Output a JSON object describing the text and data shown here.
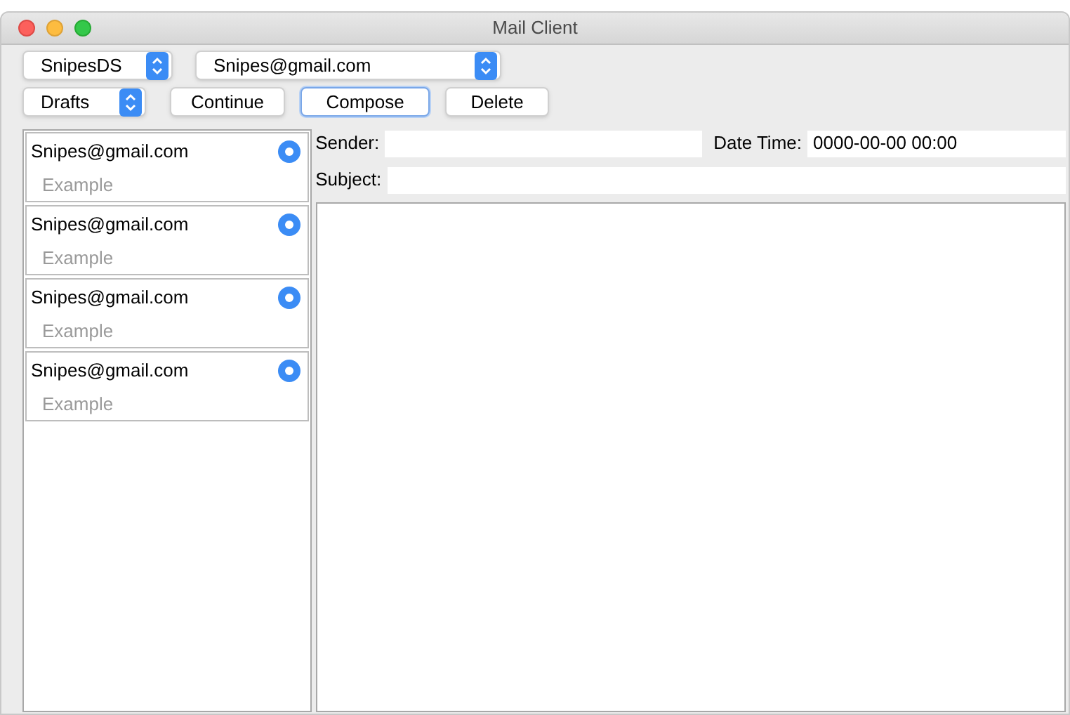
{
  "window": {
    "title": "Mail Client"
  },
  "account_select": {
    "value": "SnipesDS"
  },
  "address_select": {
    "value": "Snipes@gmail.com"
  },
  "folder_select": {
    "value": "Drafts"
  },
  "buttons": [
    {
      "label": "Continue",
      "focused": false
    },
    {
      "label": "Compose",
      "focused": true
    },
    {
      "label": "Delete",
      "focused": false
    }
  ],
  "messages": [
    {
      "sender": "Snipes@gmail.com",
      "subject": "Example",
      "selected": true
    },
    {
      "sender": "Snipes@gmail.com",
      "subject": "Example",
      "selected": true
    },
    {
      "sender": "Snipes@gmail.com",
      "subject": "Example",
      "selected": true
    },
    {
      "sender": "Snipes@gmail.com",
      "subject": "Example",
      "selected": true
    }
  ],
  "sender_field": {
    "label": "Sender:"
  },
  "date_field": {
    "label": "Date Time:",
    "value": "0000-00-00 00:00"
  },
  "subject_field": {
    "label": "Subject:"
  }
}
